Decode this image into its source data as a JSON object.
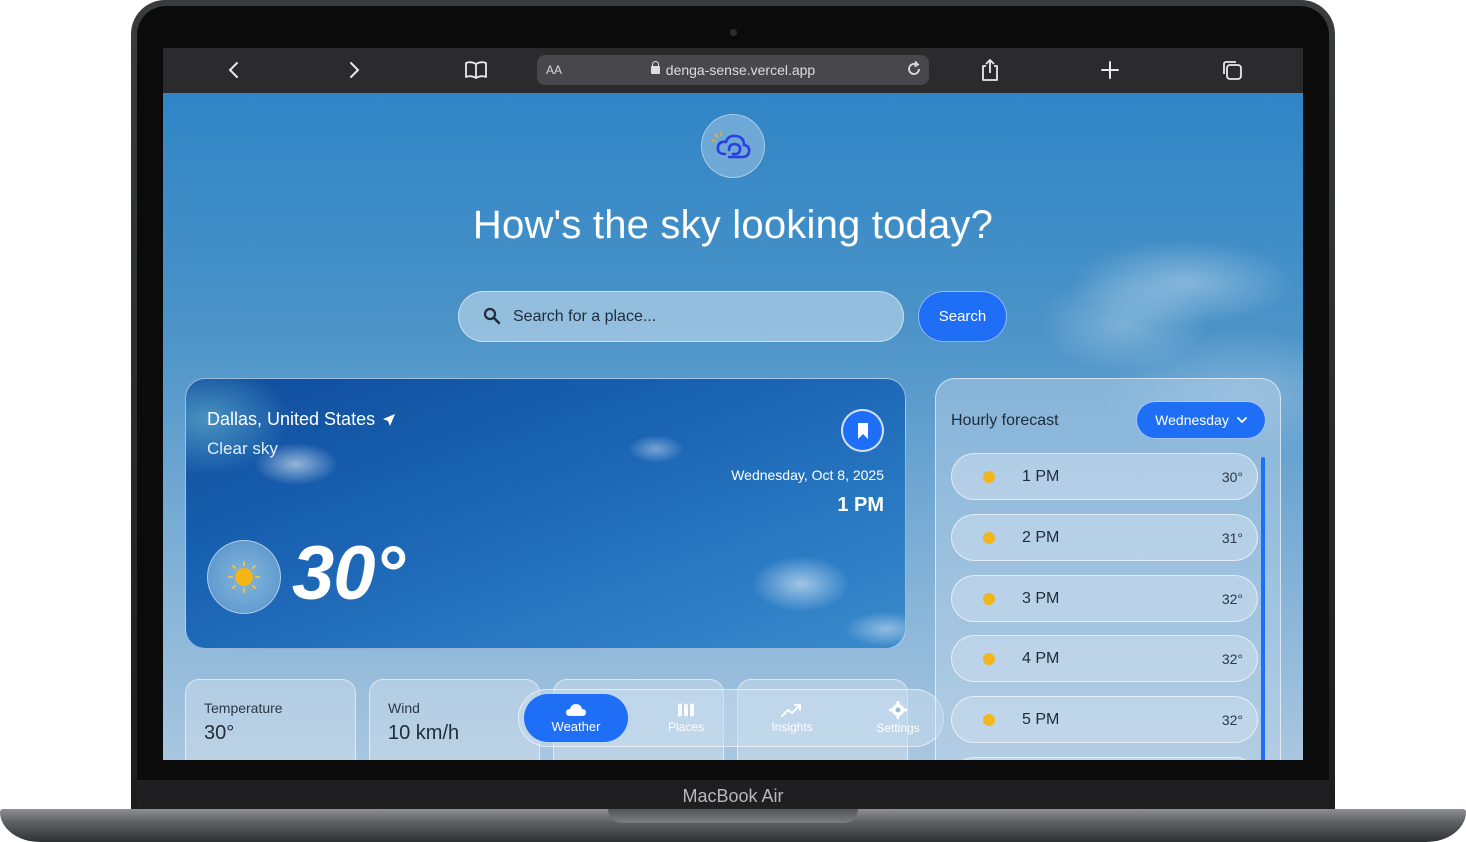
{
  "device": {
    "label": "MacBook Air"
  },
  "browser": {
    "text_size": "AA",
    "url": "denga-sense.vercel.app"
  },
  "page": {
    "headline": "How's the sky looking today?",
    "search": {
      "placeholder": "Search for a place...",
      "button_label": "Search"
    }
  },
  "current": {
    "location": "Dallas, United States",
    "condition": "Clear sky",
    "date": "Wednesday, Oct 8, 2025",
    "time": "1 PM",
    "temperature": "30°"
  },
  "stats": [
    {
      "label": "Temperature",
      "value": "30°"
    },
    {
      "label": "Wind",
      "value": "10 km/h"
    }
  ],
  "nav": [
    {
      "label": "Weather",
      "icon": "cloud-icon"
    },
    {
      "label": "Places",
      "icon": "map-icon"
    },
    {
      "label": "Insights",
      "icon": "trend-icon"
    },
    {
      "label": "Settings",
      "icon": "gear-icon"
    }
  ],
  "hourly": {
    "title": "Hourly forecast",
    "day": "Wednesday",
    "rows": [
      {
        "time": "1 PM",
        "temp": "30°"
      },
      {
        "time": "2 PM",
        "temp": "31°"
      },
      {
        "time": "3 PM",
        "temp": "32°"
      },
      {
        "time": "4 PM",
        "temp": "32°"
      },
      {
        "time": "5 PM",
        "temp": "32°"
      }
    ]
  },
  "colors": {
    "accent": "#1e6ff5",
    "sky": "#2f85c6",
    "card": "#0f4c9c"
  }
}
